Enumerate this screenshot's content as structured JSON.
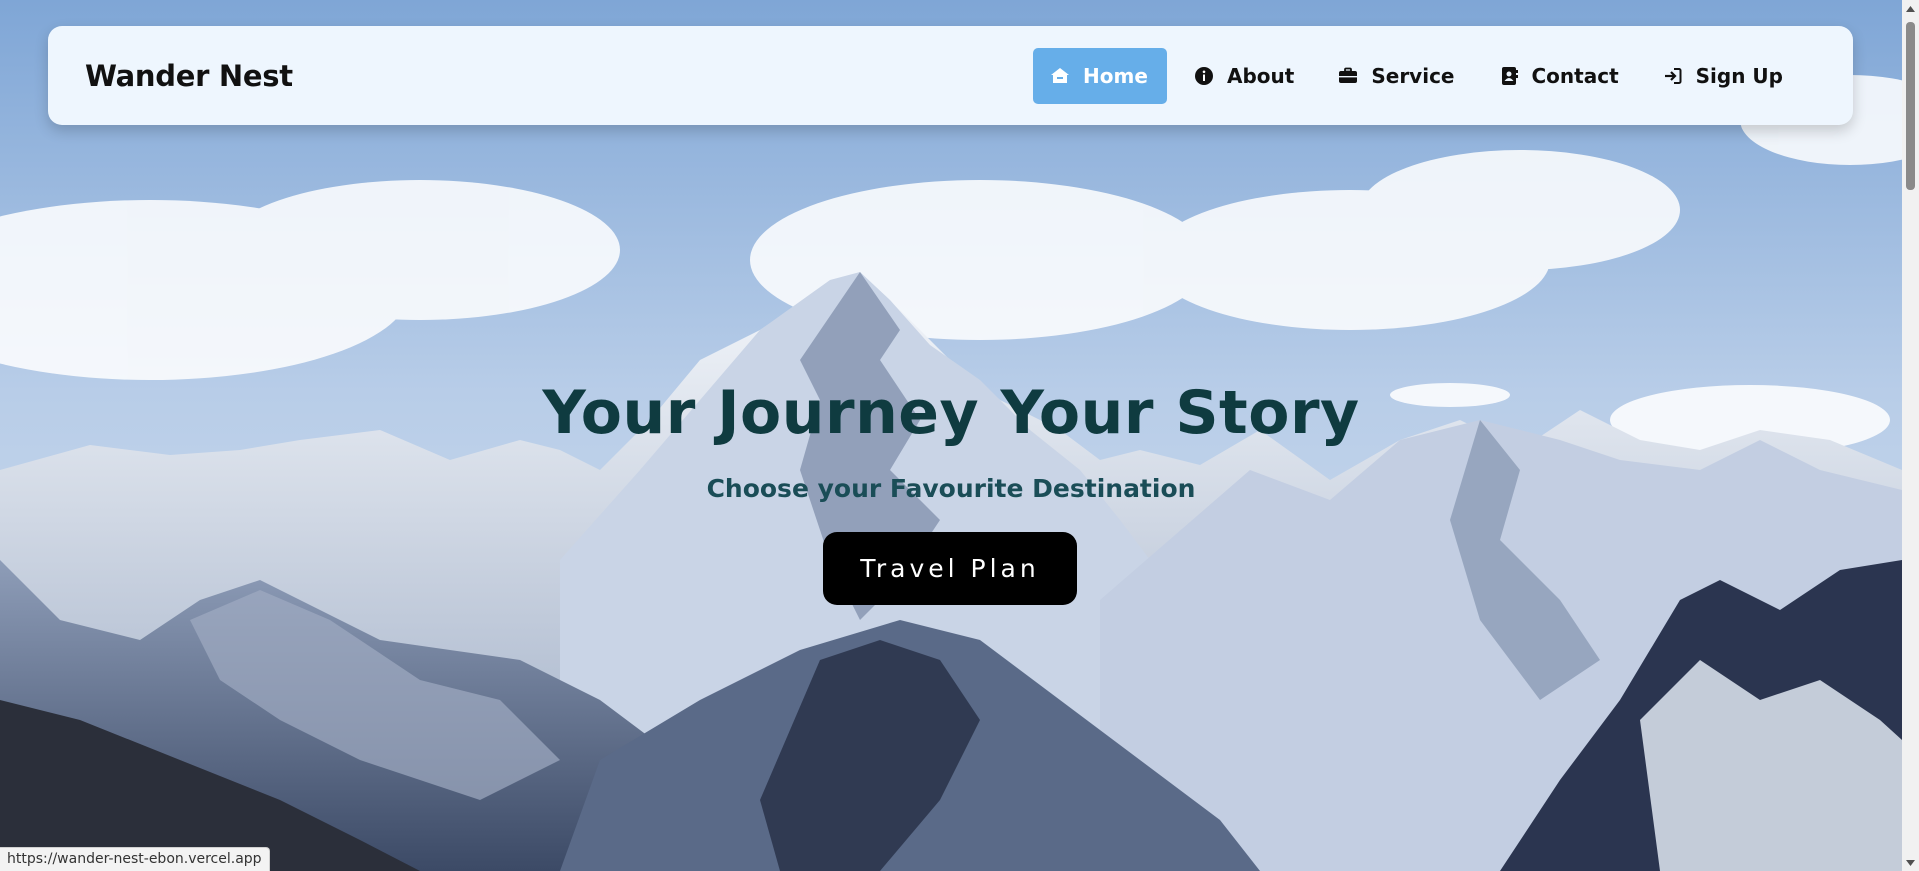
{
  "header": {
    "brand": "Wander Nest",
    "nav": [
      {
        "label": "Home",
        "icon": "home-icon",
        "active": true
      },
      {
        "label": "About",
        "icon": "info-icon",
        "active": false
      },
      {
        "label": "Service",
        "icon": "briefcase-icon",
        "active": false
      },
      {
        "label": "Contact",
        "icon": "contact-book-icon",
        "active": false
      },
      {
        "label": "Sign Up",
        "icon": "sign-in-icon",
        "active": false
      }
    ]
  },
  "hero": {
    "title": "Your Journey Your Story",
    "subtitle": "Choose your Favourite Destination",
    "cta": "Travel Plan"
  },
  "status_bar": {
    "url": "https://wander-nest-ebon.vercel.app"
  },
  "colors": {
    "nav_active_bg": "#66aee9",
    "navbar_bg": "#eef6fe",
    "title": "#0f3b40",
    "cta_bg": "#000000"
  }
}
